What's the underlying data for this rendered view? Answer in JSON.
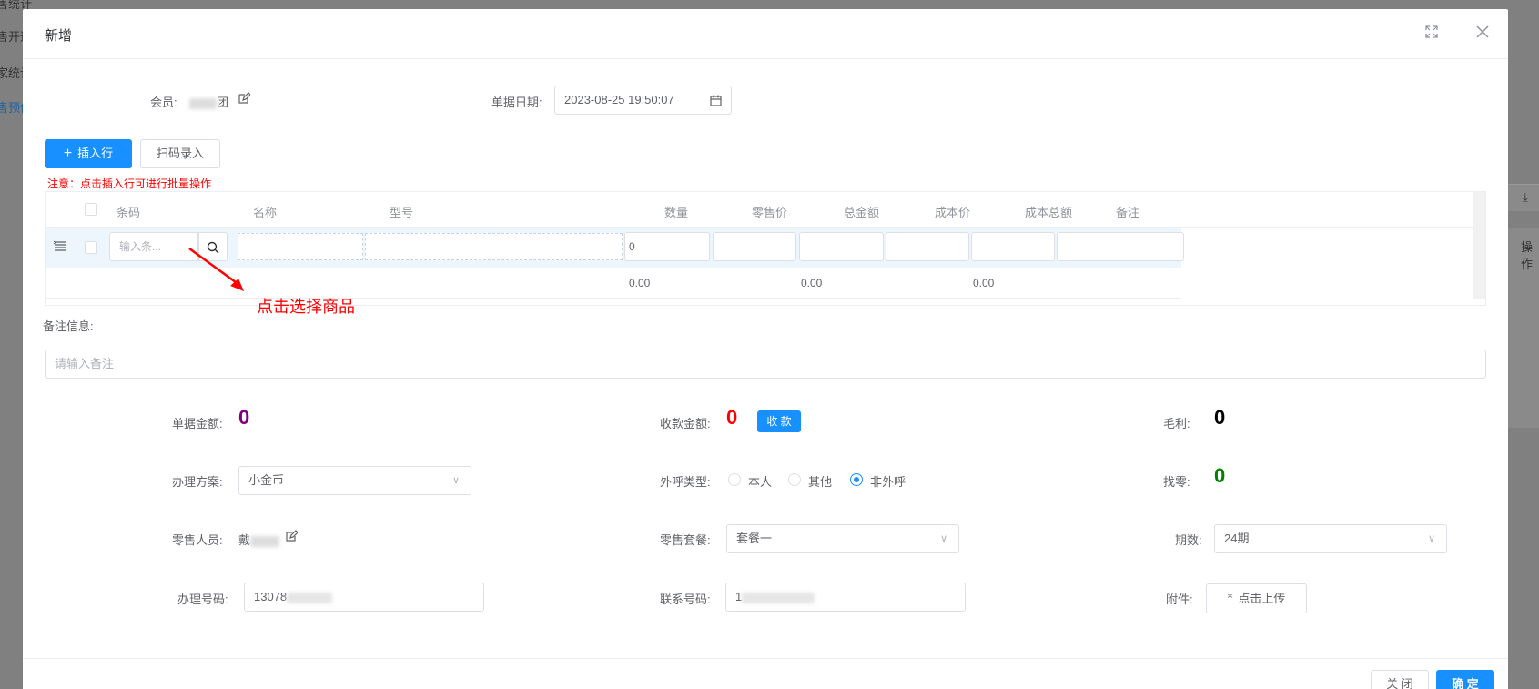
{
  "background": {
    "left_labels": [
      "售统计",
      "售开通",
      "家统计",
      "售预估"
    ],
    "right_labels": [
      "操作"
    ]
  },
  "modal": {
    "title": "新增",
    "maximize_icon": "fullscreen-icon",
    "close_icon": "close-icon"
  },
  "member": {
    "label": "会员:",
    "value_suffix": "团"
  },
  "doc_date": {
    "label": "单据日期:",
    "value": "2023-08-25 19:50:07"
  },
  "toolbar": {
    "insert_row": "插入行",
    "scan_entry": "扫码录入"
  },
  "notice": "注意：点击插入行可进行批量操作",
  "table": {
    "headers": [
      "条码",
      "名称",
      "型号",
      "数量",
      "零售价",
      "总金额",
      "成本价",
      "成本总额",
      "备注"
    ],
    "barcode_placeholder": "输入条...",
    "quantity_value": "0",
    "sum_values": [
      "0.00",
      "0.00",
      "0.00"
    ]
  },
  "annotation": "点击选择商品",
  "remark": {
    "label": "备注信息:",
    "placeholder": "请输入备注"
  },
  "summary": {
    "doc_amount_label": "单据金额:",
    "doc_amount": "0",
    "collect_amount_label": "收款金额:",
    "collect_amount": "0",
    "collect_button": "收 款",
    "gross_profit_label": "毛利:",
    "gross_profit": "0",
    "change_label": "找零:",
    "change": "0"
  },
  "plan": {
    "label": "办理方案:",
    "value": "小金币"
  },
  "call_type": {
    "label": "外呼类型:",
    "options": [
      "本人",
      "其他",
      "非外呼"
    ],
    "selected": "非外呼"
  },
  "sales_person": {
    "label": "零售人员:",
    "value_prefix": "戴"
  },
  "package": {
    "label": "零售套餐:",
    "value": "套餐一"
  },
  "periods": {
    "label": "期数:",
    "value": "24期"
  },
  "handle_number": {
    "label": "办理号码:",
    "value": "13078"
  },
  "contact_number": {
    "label": "联系号码:",
    "value": "1"
  },
  "attachment": {
    "label": "附件:",
    "upload_button": "点击上传"
  },
  "footer": {
    "close": "关 闭",
    "confirm": "确 定"
  },
  "colors": {
    "primary": "#1890ff",
    "purple": "#800080",
    "red": "#ff0000",
    "black": "#000000",
    "green": "#008000"
  }
}
